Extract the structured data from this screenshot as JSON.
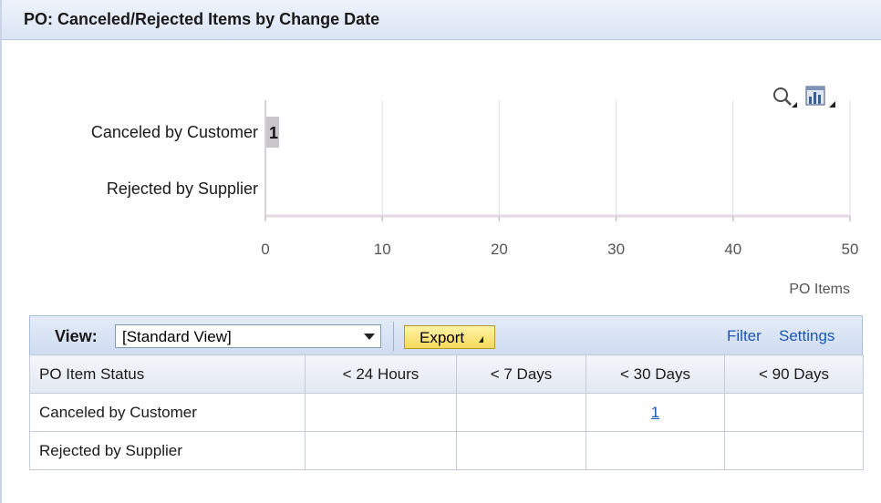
{
  "window": {
    "title": "PO: Canceled/Rejected Items by Change Date"
  },
  "chart_toolbar": {
    "icons": [
      "zoom-icon",
      "chart-type-icon"
    ]
  },
  "chart_data": {
    "type": "bar",
    "orientation": "horizontal",
    "categories": [
      "Canceled by Customer",
      "Rejected by Supplier"
    ],
    "values": [
      1,
      0
    ],
    "data_labels": [
      "1",
      ""
    ],
    "xlim": [
      0,
      50
    ],
    "xticks": [
      0,
      10,
      20,
      30,
      40,
      50
    ],
    "tick_labels": [
      "0",
      "10",
      "20",
      "30",
      "40",
      "50"
    ],
    "xlabel": "PO Items",
    "grid": true,
    "legend": "none",
    "bar_color": "#c8c6ca"
  },
  "toolbar": {
    "view_label": "View:",
    "view_value": "[Standard View]",
    "export_label": "Export",
    "filter_label": "Filter",
    "settings_label": "Settings"
  },
  "table": {
    "headers": [
      "PO Item Status",
      "< 24 Hours",
      "< 7 Days",
      "< 30 Days",
      "< 90 Days"
    ],
    "rows": [
      {
        "status": "Canceled by Customer",
        "h24": "",
        "d7": "",
        "d30": "1",
        "d90": ""
      },
      {
        "status": "Rejected by Supplier",
        "h24": "",
        "d7": "",
        "d30": "",
        "d90": ""
      }
    ]
  },
  "colors": {
    "title_bar": "#dbe5f5",
    "link": "#1c56b3",
    "export_button": "#f7d95a",
    "gridline": "#e2e2e6"
  }
}
